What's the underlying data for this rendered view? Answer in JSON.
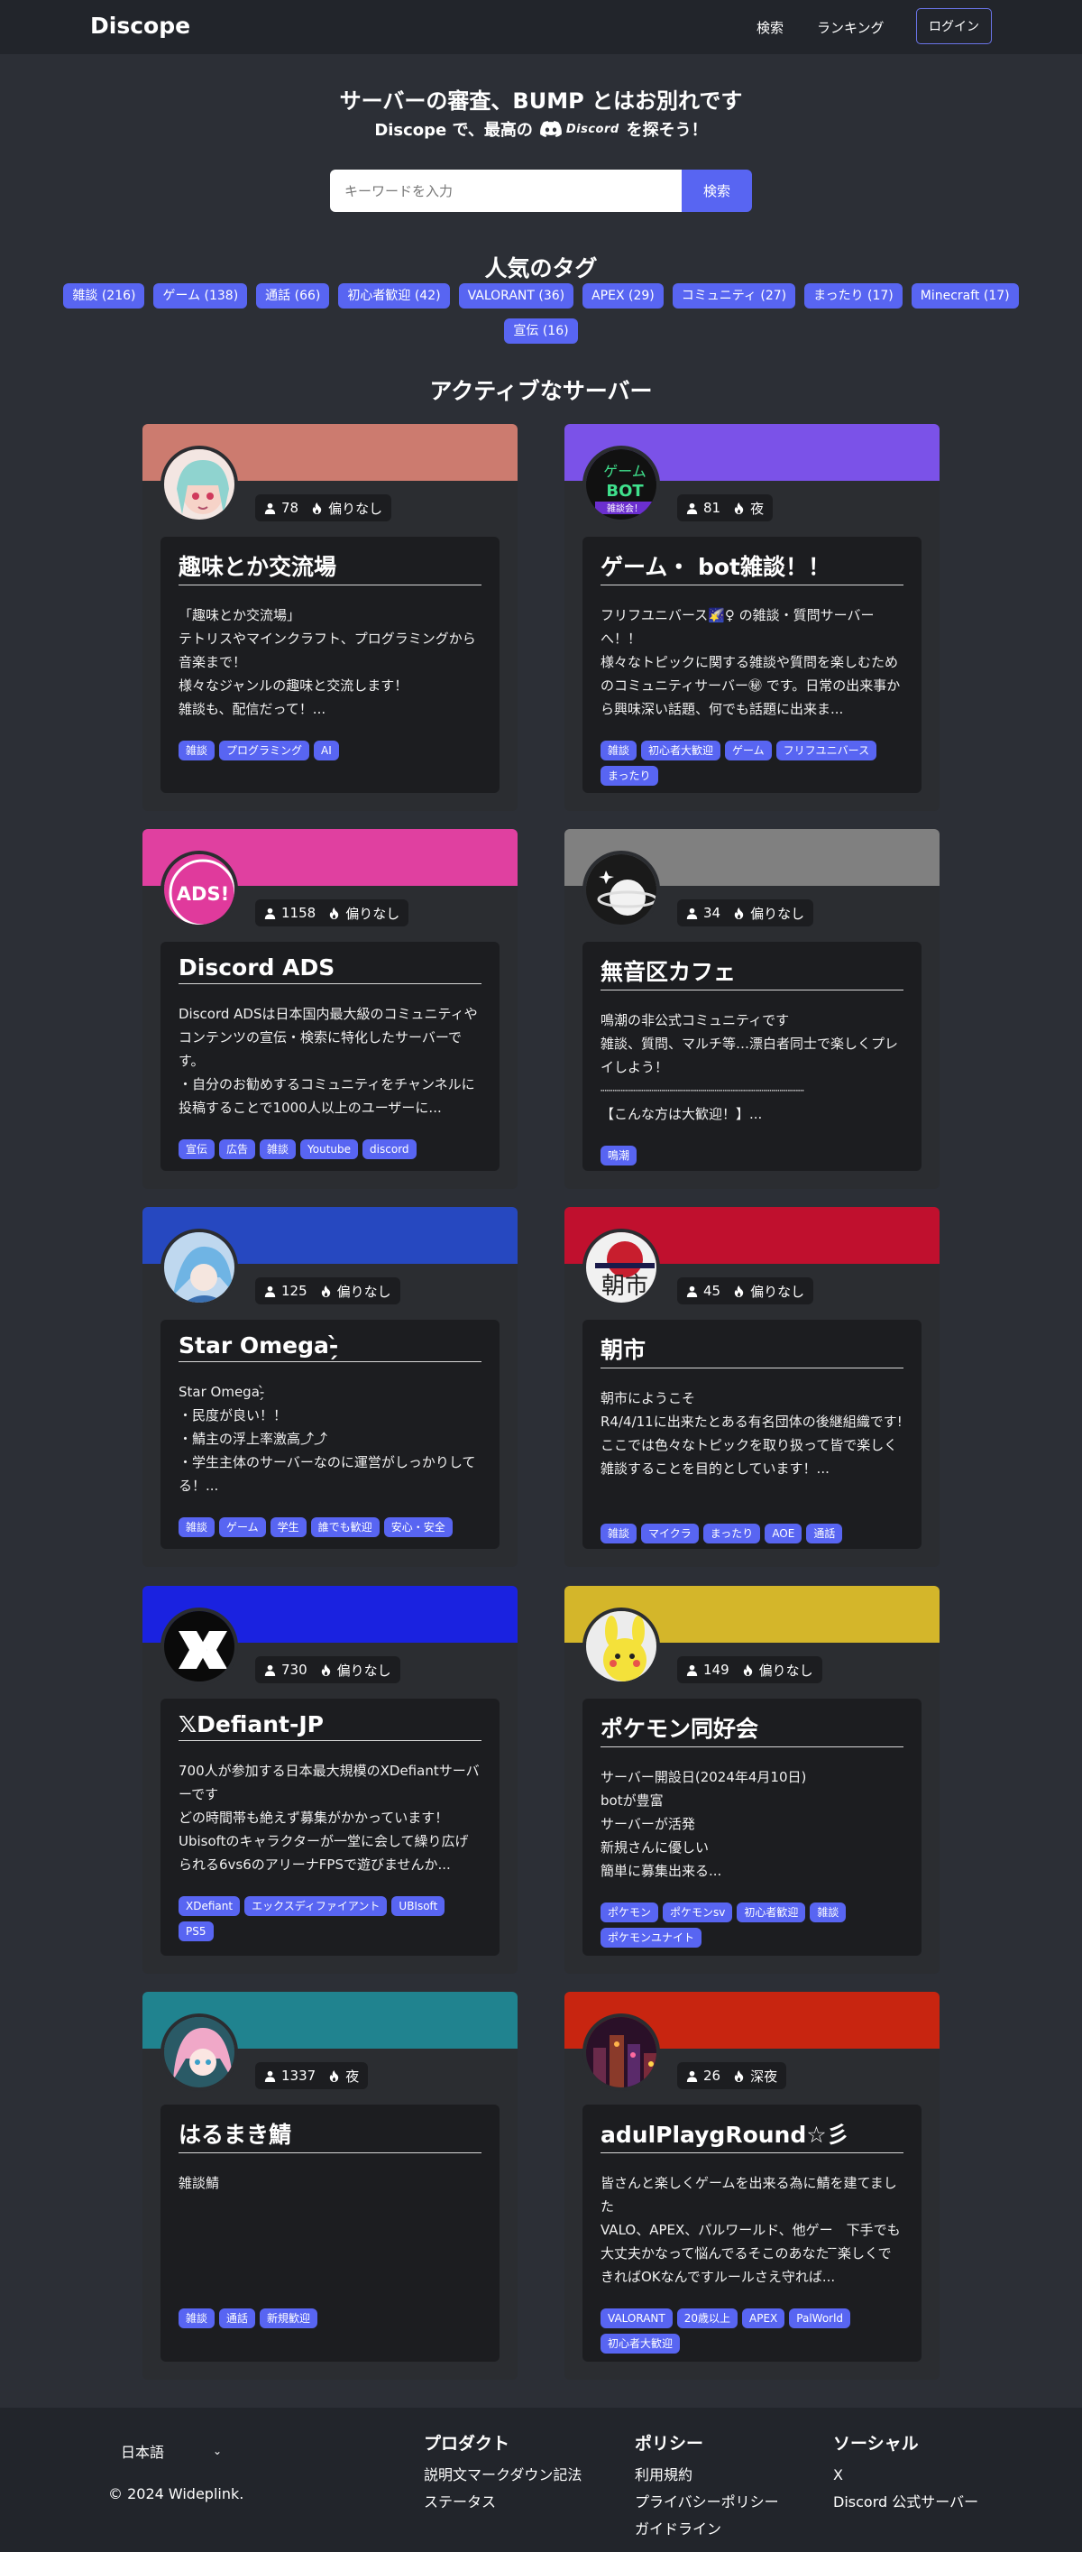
{
  "nav": {
    "brand": "Discope",
    "links": [
      "検索",
      "ランキング"
    ],
    "login": "ログイン"
  },
  "hero": {
    "title": "サーバーの審査、BUMP とはお別れです",
    "sub_before": "Discope で、最高の",
    "discord_wordmark": "Discord",
    "sub_after": "を探そう！"
  },
  "search": {
    "placeholder": "キーワードを入力",
    "button": "検索"
  },
  "popular": {
    "title": "人気のタグ",
    "row1": [
      "雑談 (216)",
      "ゲーム (138)",
      "通話 (66)",
      "初心者歓迎 (42)",
      "VALORANT (36)",
      "APEX (29)",
      "コミュニティ (27)",
      "まったり (17)",
      "Minecraft (17)"
    ],
    "row2": [
      "宣伝 (16)"
    ]
  },
  "active": {
    "title": "アクティブなサーバー"
  },
  "servers": [
    {
      "banner_color": "#cc7b6f",
      "avatar": "anime-girl-teal-hair",
      "members": "78",
      "activity": "偏りなし",
      "name": "趣味とか交流場",
      "desc": "「趣味とか交流場」\nテトリスやマインクラフト、プログラミングから音楽まで！\n様々なジャンルの趣味と交流します！\n雑談も、配信だって！...",
      "tags": [
        "雑談",
        "プログラミング",
        "AI"
      ]
    },
    {
      "banner_color": "#7b52e8",
      "avatar": "game-bot-logo",
      "members": "81",
      "activity": "夜",
      "name": "ゲーム・ bot雑談！！",
      "desc": "フリフユニバース🌠♀ の雑談・質問サーバーへ！！\n様々なトピックに関する雑談や質問を楽しむためのコミュニティサーバー㊙ です。日常の出来事から興味深い話題、何でも話題に出来ま...",
      "tags": [
        "雑談",
        "初心者大歓迎",
        "ゲーム",
        "フリフユニバース",
        "まったり"
      ]
    },
    {
      "banner_color": "#e040a0",
      "avatar": "ads-logo",
      "avatar_text": "ADS!",
      "members": "1158",
      "activity": "偏りなし",
      "name": "Discord ADS",
      "desc": "Discord ADSは日本国内最大級のコミュニティやコンテンツの宣伝・検索に特化したサーバーです。\n・自分のお勧めするコミュニティをチャンネルに投稿することで1000人以上のユーザーに...",
      "tags": [
        "宣伝",
        "広告",
        "雑談",
        "Youtube",
        "discord"
      ]
    },
    {
      "banner_color": "#808080",
      "avatar": "planet-sketch",
      "members": "34",
      "activity": "偏りなし",
      "name": "無音区カフェ",
      "desc": "鳴潮の非公式コミュニティです\n雑談、質問、マルチ等…漂白者同士で楽しくプレイしよう！\n┈┈┈┈┈┈┈┈┈┈┈┈┈┈┈┈┈┈┈┈┈┈┈┈┈\n【こんな方は大歓迎！】...",
      "tags": [
        "鳴潮"
      ]
    },
    {
      "banner_color": "#2648c0",
      "avatar": "anime-girl-blue",
      "members": "125",
      "activity": "偏りなし",
      "name": "Star Omega-̗̀ ",
      "desc": "Star Omega-̗̀ \n・民度が良い！！\n・鯖主の浮上率激高⤴︎⤴︎\n・学生主体のサーバーなのに運営がしっかりしてる！...",
      "tags": [
        "雑談",
        "ゲーム",
        "学生",
        "誰でも歓迎",
        "安心・安全"
      ]
    },
    {
      "banner_color": "#c0102e",
      "avatar": "asaichi-logo",
      "avatar_text": "朝市",
      "members": "45",
      "activity": "偏りなし",
      "name": "朝市",
      "desc": "朝市にようこそ\nR4/4/11に出来たとある有名団体の後継組織です!\nここでは色々なトピックを取り扱って皆で楽しく雑談することを目的としています！...",
      "tags": [
        "雑談",
        "マイクラ",
        "まったり",
        "AOE",
        "通話"
      ]
    },
    {
      "banner_color": "#1a22e0",
      "avatar": "xdefiant-logo",
      "members": "730",
      "activity": "偏りなし",
      "name": "𝕏Defiant-JP",
      "desc": "700人が参加する日本最大規模のXDefiantサーバーです\nどの時間帯も絶えず募集がかかっています！\nUbisoftのキャラクターが一堂に会して繰り広げられる6vs6のアリーナFPSで遊びませんか...",
      "tags": [
        "XDefiant",
        "エックスディファイアント",
        "UBIsoft",
        "PS5"
      ]
    },
    {
      "banner_color": "#d4b62a",
      "avatar": "pokemon-yellow",
      "members": "149",
      "activity": "偏りなし",
      "name": "ポケモン同好会",
      "desc": "サーバー開設日(2024年4月10日)\nbotが豊富\nサーバーが活発\n新規さんに優しい\n簡単に募集出来る...",
      "tags": [
        "ポケモン",
        "ポケモンsv",
        "初心者歓迎",
        "雑談",
        "ポケモンユナイト"
      ]
    },
    {
      "banner_color": "#20838f",
      "avatar": "anime-girl-pink",
      "members": "1337",
      "activity": "夜",
      "name": " はるまき鯖 ",
      "desc": "雑談鯖",
      "tags": [
        "雑談",
        "通話",
        "新規歓迎"
      ]
    },
    {
      "banner_color": "#c82510",
      "avatar": "neon-city",
      "members": "26",
      "activity": "深夜",
      "name": "adulPlaygRound☆彡",
      "desc": "皆さんと楽しくゲームを出来る為に鯖を建てました\nVALO、APEX、パルワールド、他ゲー　下手でも大丈夫かなって悩んでるそこのあなた ̄ ̄楽しくできればOKなんですルールさえ守れば...",
      "tags": [
        "VALORANT",
        "20歳以上",
        "APEX",
        "PalWorld",
        "初心者大歓迎"
      ]
    }
  ],
  "footer": {
    "language": "日本語",
    "copyright": "© 2024 Wideplink.",
    "product": {
      "title": "プロダクト",
      "links": [
        "説明文マークダウン記法",
        "ステータス"
      ]
    },
    "policy": {
      "title": "ポリシー",
      "links": [
        "利用規約",
        "プライバシーポリシー",
        "ガイドライン"
      ]
    },
    "social": {
      "title": "ソーシャル",
      "links": [
        "X",
        "Discord 公式サーバー"
      ]
    }
  }
}
